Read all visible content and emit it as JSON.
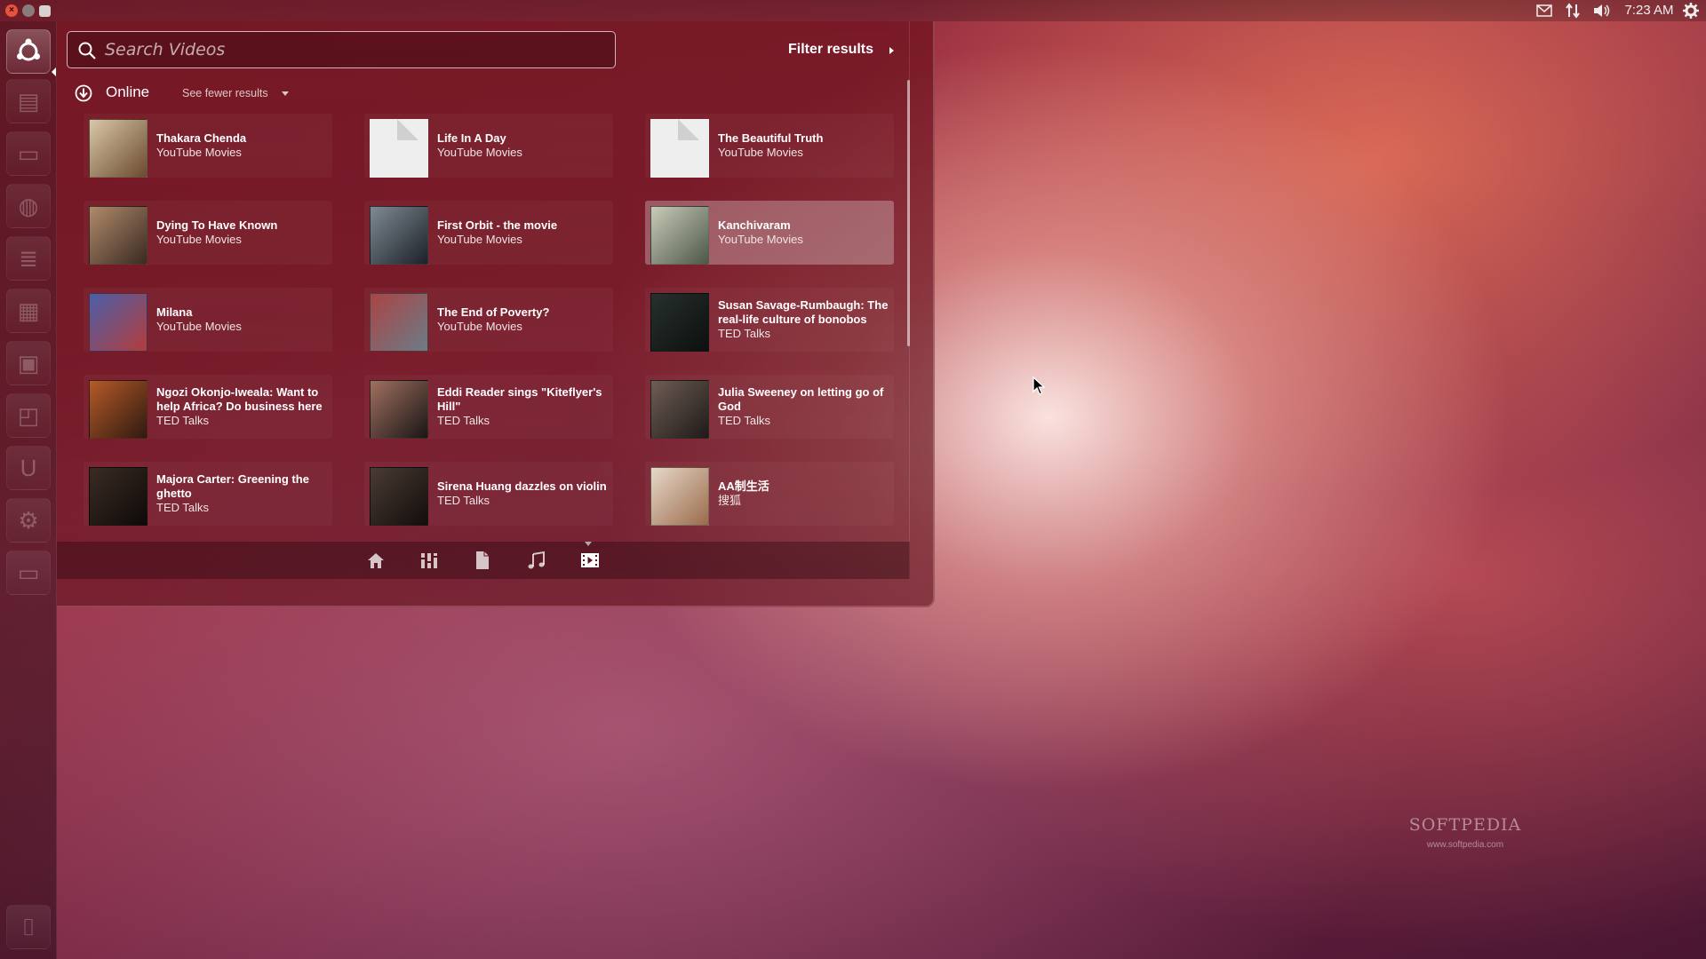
{
  "top_panel": {
    "time": "7:23 AM",
    "indicators": [
      "mail-icon",
      "network-icon",
      "volume-icon",
      "session-gear-icon"
    ]
  },
  "launcher": {
    "items": [
      "dash-home",
      "files-app",
      "home-folder",
      "firefox",
      "writer",
      "calc",
      "impress",
      "software-center",
      "ubuntu-one",
      "system-settings",
      "workspaces",
      "trash"
    ]
  },
  "search": {
    "placeholder": "Search Videos",
    "value": ""
  },
  "filter": {
    "label": "Filter results"
  },
  "category": {
    "title": "Online",
    "see_fewer": "See fewer results"
  },
  "results": [
    {
      "title": "Thakara Chenda",
      "source": "YouTube Movies",
      "thumb": "poster"
    },
    {
      "title": "Life In A Day",
      "source": "YouTube Movies",
      "thumb": "document"
    },
    {
      "title": "The Beautiful Truth",
      "source": "YouTube Movies",
      "thumb": "document"
    },
    {
      "title": "Dying To Have Known",
      "source": "YouTube Movies",
      "thumb": "poster"
    },
    {
      "title": "First Orbit - the movie",
      "source": "YouTube Movies",
      "thumb": "poster"
    },
    {
      "title": "Kanchivaram",
      "source": "YouTube Movies",
      "thumb": "poster",
      "selected": true
    },
    {
      "title": "Milana",
      "source": "YouTube Movies",
      "thumb": "poster"
    },
    {
      "title": "The End of Poverty?",
      "source": "YouTube Movies",
      "thumb": "poster"
    },
    {
      "title": "Susan Savage-Rumbaugh: The real-life culture of bonobos",
      "source": "TED Talks",
      "thumb": "poster"
    },
    {
      "title": "Ngozi Okonjo-Iweala: Want to help Africa? Do business here",
      "source": "TED Talks",
      "thumb": "poster"
    },
    {
      "title": "Eddi Reader sings \"Kiteflyer's Hill\"",
      "source": "TED Talks",
      "thumb": "poster"
    },
    {
      "title": "Julia Sweeney on letting go of God",
      "source": "TED Talks",
      "thumb": "poster"
    },
    {
      "title": "Majora Carter: Greening the ghetto",
      "source": "TED Talks",
      "thumb": "poster"
    },
    {
      "title": "Sirena Huang dazzles on violin",
      "source": "TED Talks",
      "thumb": "poster"
    },
    {
      "title": "AA制生活",
      "source": "搜狐",
      "thumb": "poster"
    }
  ],
  "lenses": [
    "home-lens-icon",
    "applications-lens-icon",
    "files-lens-icon",
    "music-lens-icon",
    "video-lens-icon"
  ],
  "active_lens": "video-lens-icon",
  "watermark": {
    "name": "SOFTPEDIA",
    "url": "www.softpedia.com"
  },
  "colors": {
    "accent": "#e5533a",
    "dash_tint": "#6e121e"
  }
}
